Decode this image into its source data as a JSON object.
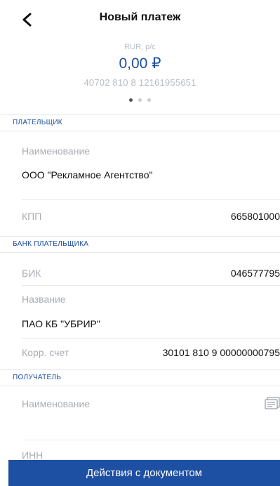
{
  "header": {
    "title": "Новый платеж"
  },
  "account": {
    "type": "RUR, р/с",
    "balance": "0,00 ₽",
    "number": "40702 810 8 12161955651",
    "pages_total": 3,
    "page_current": 1
  },
  "payer": {
    "section_title": "ПЛАТЕЛЬЩИК",
    "name_label": "Наименование",
    "name_value": "ООО \"Рекламное Агентство\"",
    "kpp_label": "КПП",
    "kpp_value": "665801000"
  },
  "payer_bank": {
    "section_title": "БАНК ПЛАТЕЛЬЩИКА",
    "bik_label": "БИК",
    "bik_value": "046577795",
    "name_label": "Название",
    "name_value": "ПАО КБ \"УБРИР\"",
    "corr_label": "Корр. счет",
    "corr_value": "30101 810 9 00000000795"
  },
  "recipient": {
    "section_title": "ПОЛУЧАТЕЛЬ",
    "name_label": "Наименование",
    "inn_label": "ИНН"
  },
  "actions": {
    "documents_label": "Действия с документом"
  },
  "colors": {
    "accent": "#1d4fa3",
    "muted": "#a9adb4",
    "divider": "#e6e8ec"
  }
}
